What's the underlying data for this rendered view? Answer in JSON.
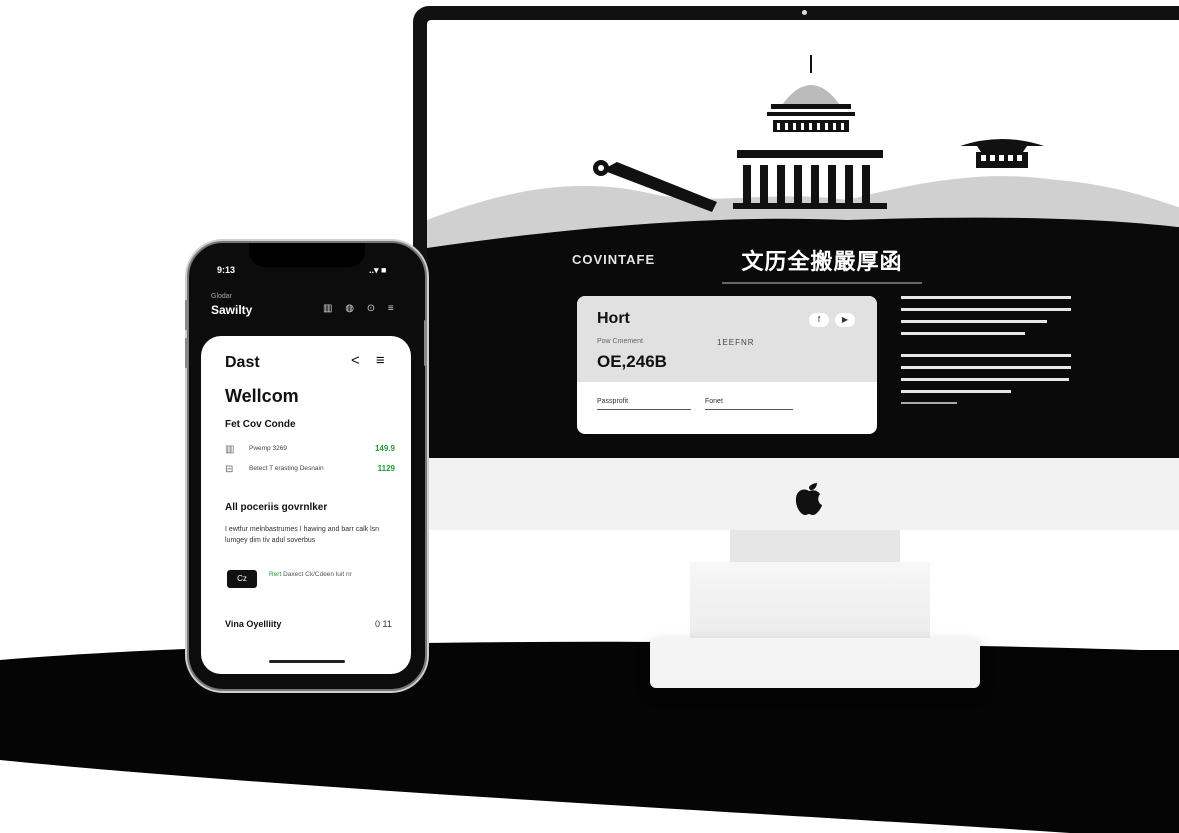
{
  "monitor": {
    "brand_left": "COVINTAFE",
    "brand_right": "文历全搬嚴厚函",
    "card": {
      "title": "Hort",
      "subtitle": "Pow Cmement",
      "code": "1EEFNR",
      "value": "OE,246B",
      "field_left": "Passprofit",
      "field_right": "Fonet",
      "buttons": [
        "f",
        "▶"
      ]
    }
  },
  "phone": {
    "time": "9:13",
    "status": "..▾ ■",
    "eyebrow": "Glodar",
    "app_title": "Sawilty",
    "header_icons": "▥ ◍ ⊙ ≡",
    "screen_title": "Dast",
    "nav_icons": "< ≡",
    "welcome": "Wellcom",
    "section1": "Fet Cov Conde",
    "rows": [
      {
        "icon": "▥",
        "label": "Pwemp 3269",
        "amount": "149.9"
      },
      {
        "icon": "⊟",
        "label": "Betect T erasting Desnain",
        "amount": "1129"
      }
    ],
    "section2": "All poceriis govrnlker",
    "paragraph": "I ewtfur melnbastrumes I hawing and barr calk lsn lumgey dim tiv adul soverbus",
    "button": "Cz",
    "note_green": "Rert",
    "note": "Daxect Ck/Cdeen luit nr",
    "footer_label": "Vina Oyelliity",
    "footer_right": "0 11"
  },
  "colors": {
    "accent_green": "#1f9a3c",
    "dark": "#0c0c0c"
  }
}
